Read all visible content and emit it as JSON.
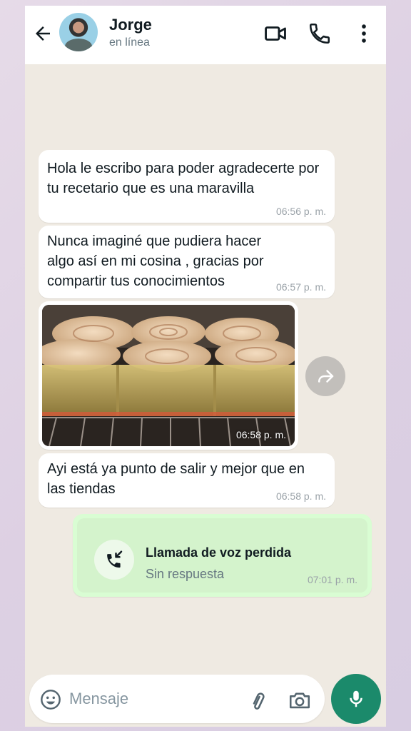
{
  "header": {
    "title": "Jorge",
    "status": "en línea",
    "icons": [
      "back-arrow-icon",
      "video-call-icon",
      "phone-icon",
      "more-vertical-icon"
    ]
  },
  "messages": [
    {
      "text": "Hola le escribo para poder agradecerte por tu recetario que es una maravilla",
      "time": "06:56 p. m."
    },
    {
      "text": "Nunca imaginé que pudiera hacer algo así en mi cosina , gracias por compartir tus conocimientos",
      "time": "06:57 p. m."
    },
    {
      "image": "photo-bread-rolls-in-oven",
      "time": "06:58 p. m."
    },
    {
      "text": "Ayi está ya punto de salir y mejor que en las tiendas",
      "time": "06:58 p. m."
    }
  ],
  "missed_call": {
    "title": "Llamada de voz perdida",
    "subtitle": "Sin respuesta",
    "time": "07:01 p. m."
  },
  "composer": {
    "placeholder": "Mensaje",
    "icons": [
      "emoji-icon",
      "attach-icon",
      "camera-icon",
      "mic-icon"
    ]
  },
  "colors": {
    "accent": "#1b8a6b",
    "chat_bg": "#efeae2",
    "outgoing_bubble": "#d9fdd3",
    "incoming_bubble": "#ffffff"
  }
}
